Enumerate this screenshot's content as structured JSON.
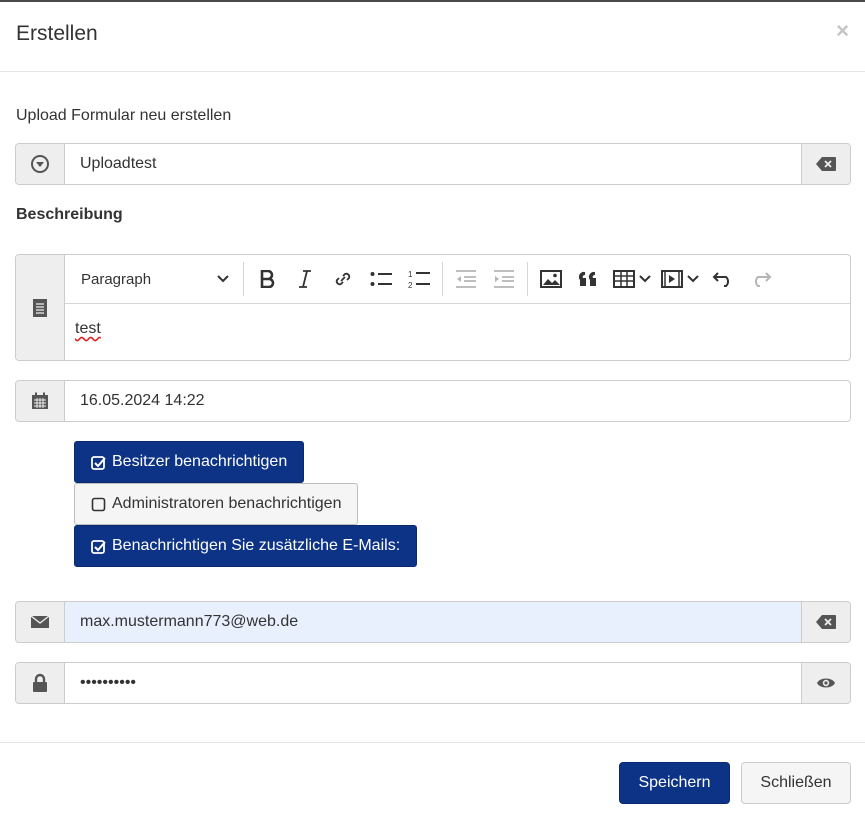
{
  "modal": {
    "title": "Erstellen",
    "close_symbol": "×"
  },
  "form": {
    "upload_label": "Upload Formular neu erstellen",
    "name": {
      "value": "Uploadtest",
      "left_icon": "download-circle-icon",
      "right_icon": "backspace-clear-icon"
    },
    "description_label": "Beschreibung",
    "editor": {
      "left_icon": "document-icon",
      "format_select": "Paragraph",
      "toolbar": [
        "bold-icon",
        "italic-icon",
        "link-icon",
        "bulleted-list-icon",
        "numbered-list-icon",
        "outdent-icon",
        "indent-icon",
        "image-icon",
        "blockquote-icon",
        "table-icon",
        "media-icon",
        "undo-icon",
        "redo-icon"
      ],
      "content": "test"
    },
    "date": {
      "value": "16.05.2024 14:22",
      "left_icon": "calendar-icon"
    },
    "notify": [
      {
        "label": "Besitzer benachrichtigen",
        "checked": true
      },
      {
        "label": "Administratoren benachrichtigen",
        "checked": false
      },
      {
        "label": "Benachrichtigen Sie zusätzliche E-Mails:",
        "checked": true
      }
    ],
    "email": {
      "value": "max.mustermann773@web.de",
      "left_icon": "envelope-icon",
      "right_icon": "backspace-clear-icon"
    },
    "password": {
      "value": "••••••••••",
      "left_icon": "lock-icon",
      "right_icon": "eye-icon"
    }
  },
  "footer": {
    "save_label": "Speichern",
    "close_label": "Schließen"
  },
  "colors": {
    "primary": "#0d3386",
    "addon_bg": "#eeeeee",
    "autofill_bg": "#e8f0fe"
  }
}
